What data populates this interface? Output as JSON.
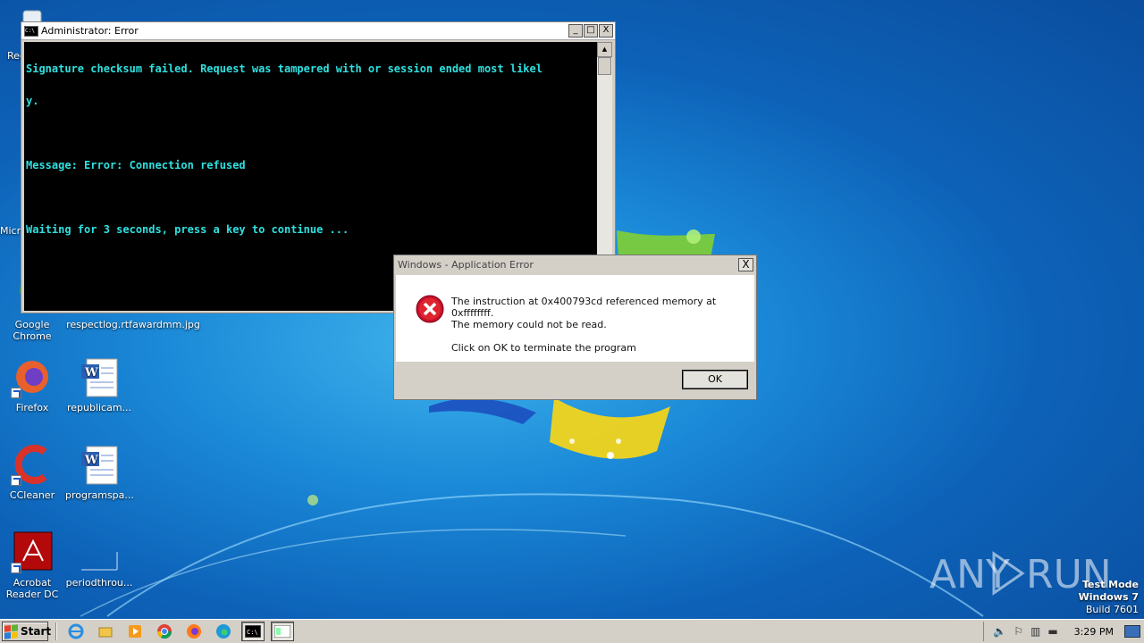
{
  "desktop_icons": [
    {
      "label": "Rec",
      "icon": "recycle-bin-icon"
    },
    {
      "label": "Micr",
      "icon": "edge-icon"
    },
    {
      "label": "Google Chrome",
      "icon": "chrome-icon"
    },
    {
      "label": "respectlog.rtf",
      "icon": "rtf-file-icon"
    },
    {
      "label": "awardmm.jpg",
      "icon": "image-file-icon"
    },
    {
      "label": "Firefox",
      "icon": "firefox-icon"
    },
    {
      "label": "republicam...",
      "icon": "word-doc-icon"
    },
    {
      "label": "CCleaner",
      "icon": "ccleaner-icon"
    },
    {
      "label": "programspa...",
      "icon": "word-doc-icon"
    },
    {
      "label": "Acrobat Reader DC",
      "icon": "acrobat-icon"
    },
    {
      "label": "periodthrou...",
      "icon": "blank-file-icon"
    }
  ],
  "console": {
    "title": "Administrator: Error",
    "icon_text": "C:\\",
    "lines": [
      "Signature checksum failed. Request was tampered with or session ended most likel",
      "y.",
      "",
      "Message: Error: Connection refused",
      "",
      "Waiting for 3 seconds, press a key to continue ..."
    ],
    "buttons": {
      "minimize": "_",
      "maximize": "□",
      "close": "X"
    }
  },
  "dialog": {
    "title": "Windows - Application Error",
    "close": "X",
    "message_line1": "The instruction at 0x400793cd referenced memory at 0xffffffff.",
    "message_line2": "The memory could not be read.",
    "message_line3": "Click on OK to terminate the program",
    "ok_label": "OK"
  },
  "watermark": {
    "text_left": "ANY",
    "text_right": "RUN"
  },
  "test_mode": {
    "line1": "Test Mode",
    "line2": "Windows 7",
    "line3": "Build 7601"
  },
  "taskbar": {
    "start_label": "Start",
    "pinned": [
      "ie-icon",
      "explorer-icon",
      "media-player-icon",
      "chrome-icon",
      "firefox-icon",
      "edge-icon",
      "cmd-icon",
      "app-window-icon"
    ],
    "clock": "3:29 PM"
  }
}
